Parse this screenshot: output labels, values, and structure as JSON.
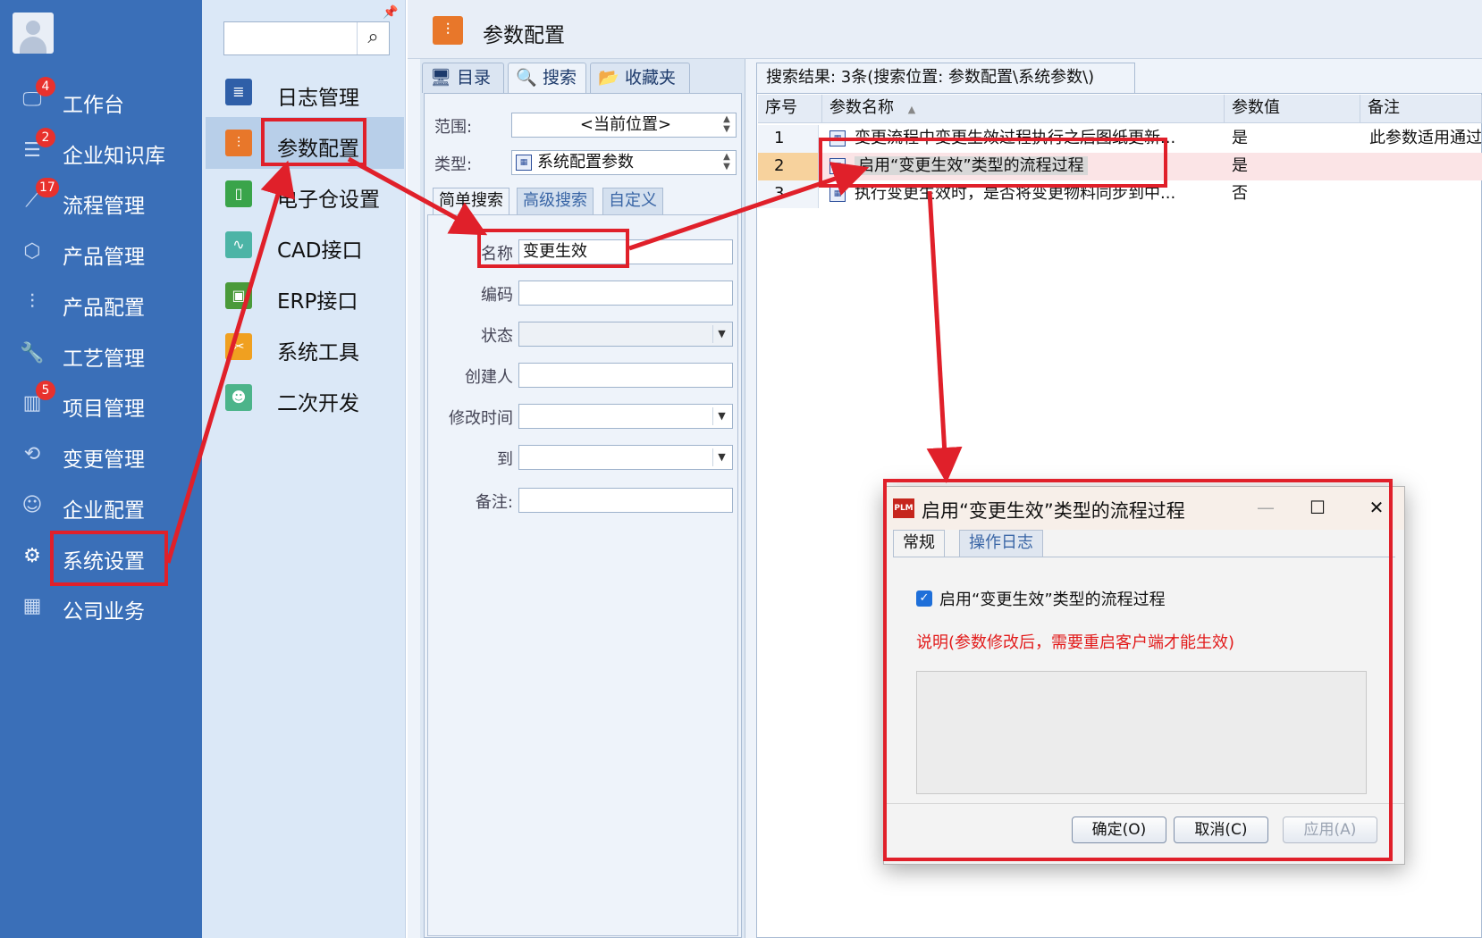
{
  "nav": {
    "items": [
      {
        "label": "工作台",
        "icon": "monitor-icon",
        "badge": "4"
      },
      {
        "label": "企业知识库",
        "icon": "book-icon",
        "badge": "2"
      },
      {
        "label": "流程管理",
        "icon": "flow-icon",
        "badge": "17"
      },
      {
        "label": "产品管理",
        "icon": "cube-icon",
        "badge": ""
      },
      {
        "label": "产品配置",
        "icon": "sliders-icon",
        "badge": ""
      },
      {
        "label": "工艺管理",
        "icon": "wrench-icon",
        "badge": ""
      },
      {
        "label": "项目管理",
        "icon": "chart-icon",
        "badge": "5"
      },
      {
        "label": "变更管理",
        "icon": "change-icon",
        "badge": ""
      },
      {
        "label": "企业配置",
        "icon": "users-icon",
        "badge": ""
      },
      {
        "label": "系统设置",
        "icon": "gear-icon",
        "badge": ""
      },
      {
        "label": "公司业务",
        "icon": "grid-icon",
        "badge": ""
      }
    ]
  },
  "submenu": {
    "search_placeholder": "",
    "items": [
      {
        "label": "日志管理",
        "color": "#2f5fa8"
      },
      {
        "label": "参数配置",
        "color": "#e8772a"
      },
      {
        "label": "电子仓设置",
        "color": "#3aa44a"
      },
      {
        "label": "CAD接口",
        "color": "#4cb4a6"
      },
      {
        "label": "ERP接口",
        "color": "#4a9a3a"
      },
      {
        "label": "系统工具",
        "color": "#f0a020"
      },
      {
        "label": "二次开发",
        "color": "#4cb48a"
      }
    ]
  },
  "header": {
    "title": "参数配置"
  },
  "panel": {
    "tabs": [
      "目录",
      "搜索",
      "收藏夹"
    ],
    "scope_label": "范围:",
    "scope_value": "<当前位置>",
    "type_label": "类型:",
    "type_value": "系统配置参数",
    "search_tabs": [
      "简单搜索",
      "高级搜索",
      "自定义"
    ],
    "fields": {
      "name_label": "名称",
      "name_value": "变更生效",
      "code_label": "编码",
      "status_label": "状态",
      "creator_label": "创建人",
      "modtime_label": "修改时间",
      "to_label": "到",
      "remark_label": "备注:"
    }
  },
  "results": {
    "tab_label": "搜索结果: 3条(搜索位置: 参数配置\\系统参数\\)",
    "columns": [
      "序号",
      "参数名称",
      "参数值",
      "备注"
    ],
    "sort_indicator": "▲",
    "rows": [
      {
        "num": "1",
        "name": "变更流程中变更生效过程执行之后图纸更新...",
        "value": "是",
        "remark": "此参数适用通过"
      },
      {
        "num": "2",
        "name": "启用“变更生效”类型的流程过程",
        "value": "是",
        "remark": ""
      },
      {
        "num": "3",
        "name": "执行变更生效时，是否将变更物料同步到中...",
        "value": "否",
        "remark": ""
      }
    ]
  },
  "dialog": {
    "icon_text": "PLM",
    "title": "启用“变更生效”类型的流程过程",
    "tabs": [
      "常规",
      "操作日志"
    ],
    "checkbox_label": "启用“变更生效”类型的流程过程",
    "note": "说明(参数修改后，需要重启客户端才能生效)",
    "buttons": {
      "ok": "确定(O)",
      "cancel": "取消(C)",
      "apply": "应用(A)"
    },
    "window_buttons": {
      "minimize": "—",
      "maximize": "☐",
      "close": "✕"
    }
  },
  "colors": {
    "annotation": "#e0202a",
    "nav_bg": "#3a6fb8",
    "badge": "#e8312d"
  }
}
